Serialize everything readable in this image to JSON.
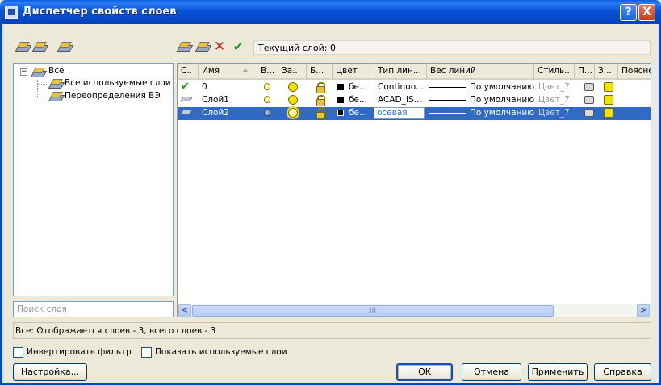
{
  "window": {
    "title": "Диспетчер свойств слоев",
    "help_label": "?",
    "close_label": "X"
  },
  "toolbar": {
    "current_layer": "Текущий слой: 0"
  },
  "tree": {
    "root_label": "Все",
    "expander": "−",
    "children": [
      "Все используемые слои",
      "Переопределения ВЭ"
    ]
  },
  "search": {
    "placeholder": "Поиск слоя"
  },
  "grid": {
    "columns": [
      "С..",
      "Имя",
      "В...",
      "За...",
      "Б...",
      "Цвет",
      "Тип лин...",
      "Вес линий",
      "Стиль...",
      "П...",
      "З...",
      "Поясне"
    ],
    "rows": [
      {
        "name": "0",
        "color": "бе...",
        "linetype": "Continuo...",
        "lineweight": "По умолчанию",
        "style": "Цвет_7",
        "current": true
      },
      {
        "name": "Слой1",
        "color": "бе...",
        "linetype": "ACAD_IS...",
        "lineweight": "По умолчанию",
        "style": "Цвет_7",
        "current": false
      },
      {
        "name": "Слой2",
        "color": "бе...",
        "linetype": "осевая",
        "lineweight": "По умолчанию",
        "style": "Цвет_7",
        "current": false,
        "selected": true
      }
    ],
    "scroll_left": "<",
    "scroll_right": ">",
    "scroll_grip": "III"
  },
  "status": {
    "text": "Все: Отображается слоев - 3, всего слоев - 3"
  },
  "options": {
    "invert_filter": "Инвертировать фильтр",
    "show_used": "Показать используемые слои"
  },
  "buttons": {
    "settings": "Настройка...",
    "ok": "OK",
    "cancel": "Отмена",
    "apply": "Применить",
    "help": "Справка"
  },
  "colors": {
    "selection": "#316ac5",
    "titlebar": "#0548c6",
    "dialog_bg": "#ece9d8"
  }
}
